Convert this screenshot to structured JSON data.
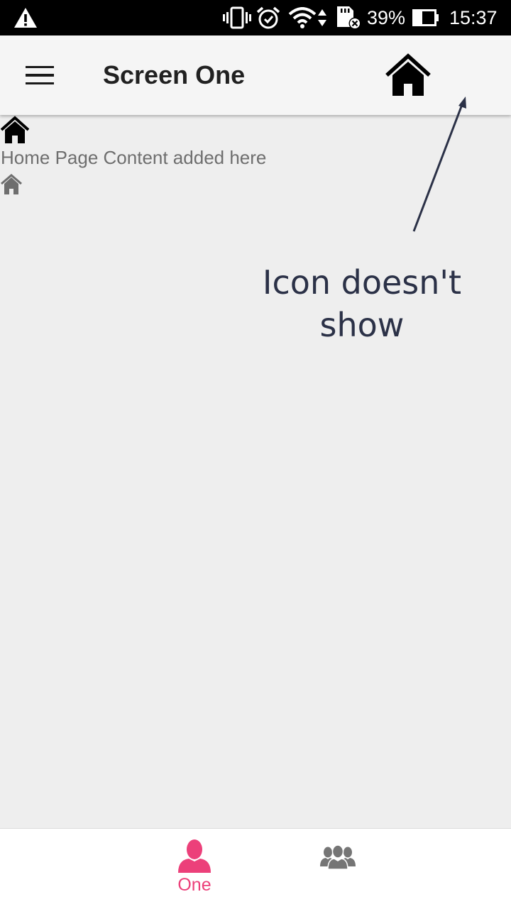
{
  "status_bar": {
    "battery_percent": "39%",
    "time": "15:37",
    "icons": [
      "warning-icon",
      "vibrate-icon",
      "alarm-icon",
      "wifi-icon",
      "data-arrows-icon",
      "sd-card-error-icon",
      "battery-icon"
    ]
  },
  "app_bar": {
    "title": "Screen One",
    "menu_icon": "menu-icon",
    "action_icon": "home-icon"
  },
  "content": {
    "text": "Home Page Content added here",
    "icons": [
      "home-icon",
      "home-icon"
    ]
  },
  "annotation": {
    "text_line1": "Icon doesn't",
    "text_line2": "show"
  },
  "bottom_nav": {
    "tabs": [
      {
        "label": "One",
        "icon": "person-icon",
        "selected": true
      },
      {
        "label": "",
        "icon": "group-icon",
        "selected": false
      }
    ]
  },
  "colors": {
    "accent": "#ec407a",
    "app_bar_bg": "#f5f5f5",
    "page_bg": "#eeeeee",
    "status_bar_bg": "#000000",
    "annotation": "#2b3147"
  }
}
